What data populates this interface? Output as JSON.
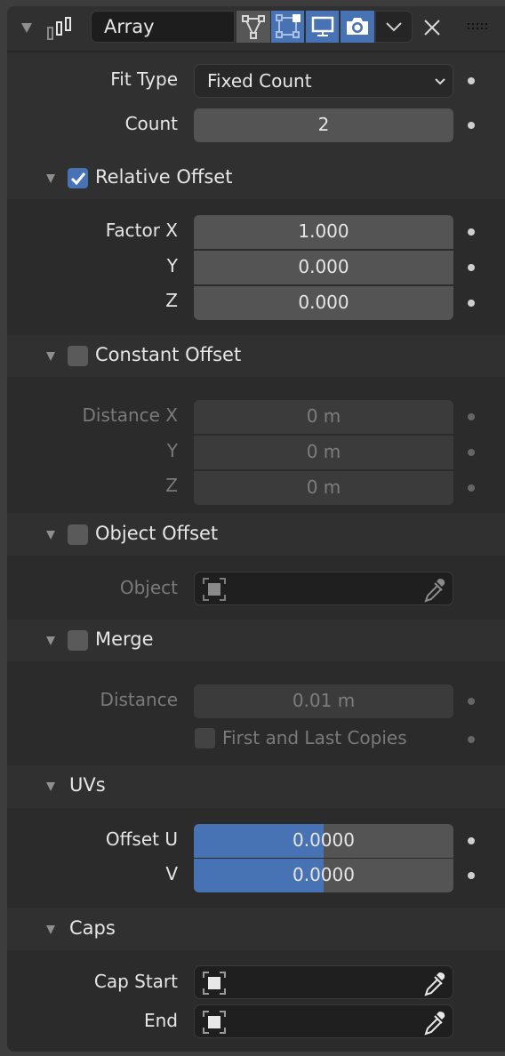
{
  "modifier": {
    "name": "Array",
    "type_icon": "array-modifier-icon",
    "toggles": [
      {
        "name": "edit-mode-toggle",
        "icon": "edit-mode-icon",
        "active": false
      },
      {
        "name": "cage-toggle",
        "icon": "on-cage-icon",
        "active": true
      },
      {
        "name": "viewport-toggle",
        "icon": "monitor-icon",
        "active": true
      },
      {
        "name": "render-toggle",
        "icon": "camera-icon",
        "active": true
      }
    ],
    "dropdown_icon": "chevron-down-icon",
    "close_icon": "close-icon",
    "drag_icon": "drag-handle-icon"
  },
  "fit_type": {
    "label": "Fit Type",
    "value": "Fixed Count"
  },
  "count": {
    "label": "Count",
    "value": "2"
  },
  "relative_offset": {
    "title": "Relative Offset",
    "enabled": true,
    "rows": [
      {
        "label": "Factor X",
        "value": "1.000"
      },
      {
        "label": "Y",
        "value": "0.000"
      },
      {
        "label": "Z",
        "value": "0.000"
      }
    ]
  },
  "constant_offset": {
    "title": "Constant Offset",
    "enabled": false,
    "rows": [
      {
        "label": "Distance X",
        "value": "0 m"
      },
      {
        "label": "Y",
        "value": "0 m"
      },
      {
        "label": "Z",
        "value": "0 m"
      }
    ]
  },
  "object_offset": {
    "title": "Object Offset",
    "enabled": false,
    "object_label": "Object",
    "object_value": ""
  },
  "merge": {
    "title": "Merge",
    "enabled": false,
    "distance_label": "Distance",
    "distance_value": "0.01 m",
    "first_last_label": "First and Last Copies",
    "first_last_checked": false
  },
  "uvs": {
    "title": "UVs",
    "rows": [
      {
        "label": "Offset U",
        "value": "0.0000",
        "fill_fraction": 0.5
      },
      {
        "label": "V",
        "value": "0.0000",
        "fill_fraction": 0.5
      }
    ]
  },
  "caps": {
    "title": "Caps",
    "rows": [
      {
        "label": "Cap Start",
        "value": ""
      },
      {
        "label": "End",
        "value": ""
      }
    ]
  },
  "colors": {
    "accent": "#4772b3",
    "panel": "#2b2b2b",
    "field": "#545454"
  }
}
